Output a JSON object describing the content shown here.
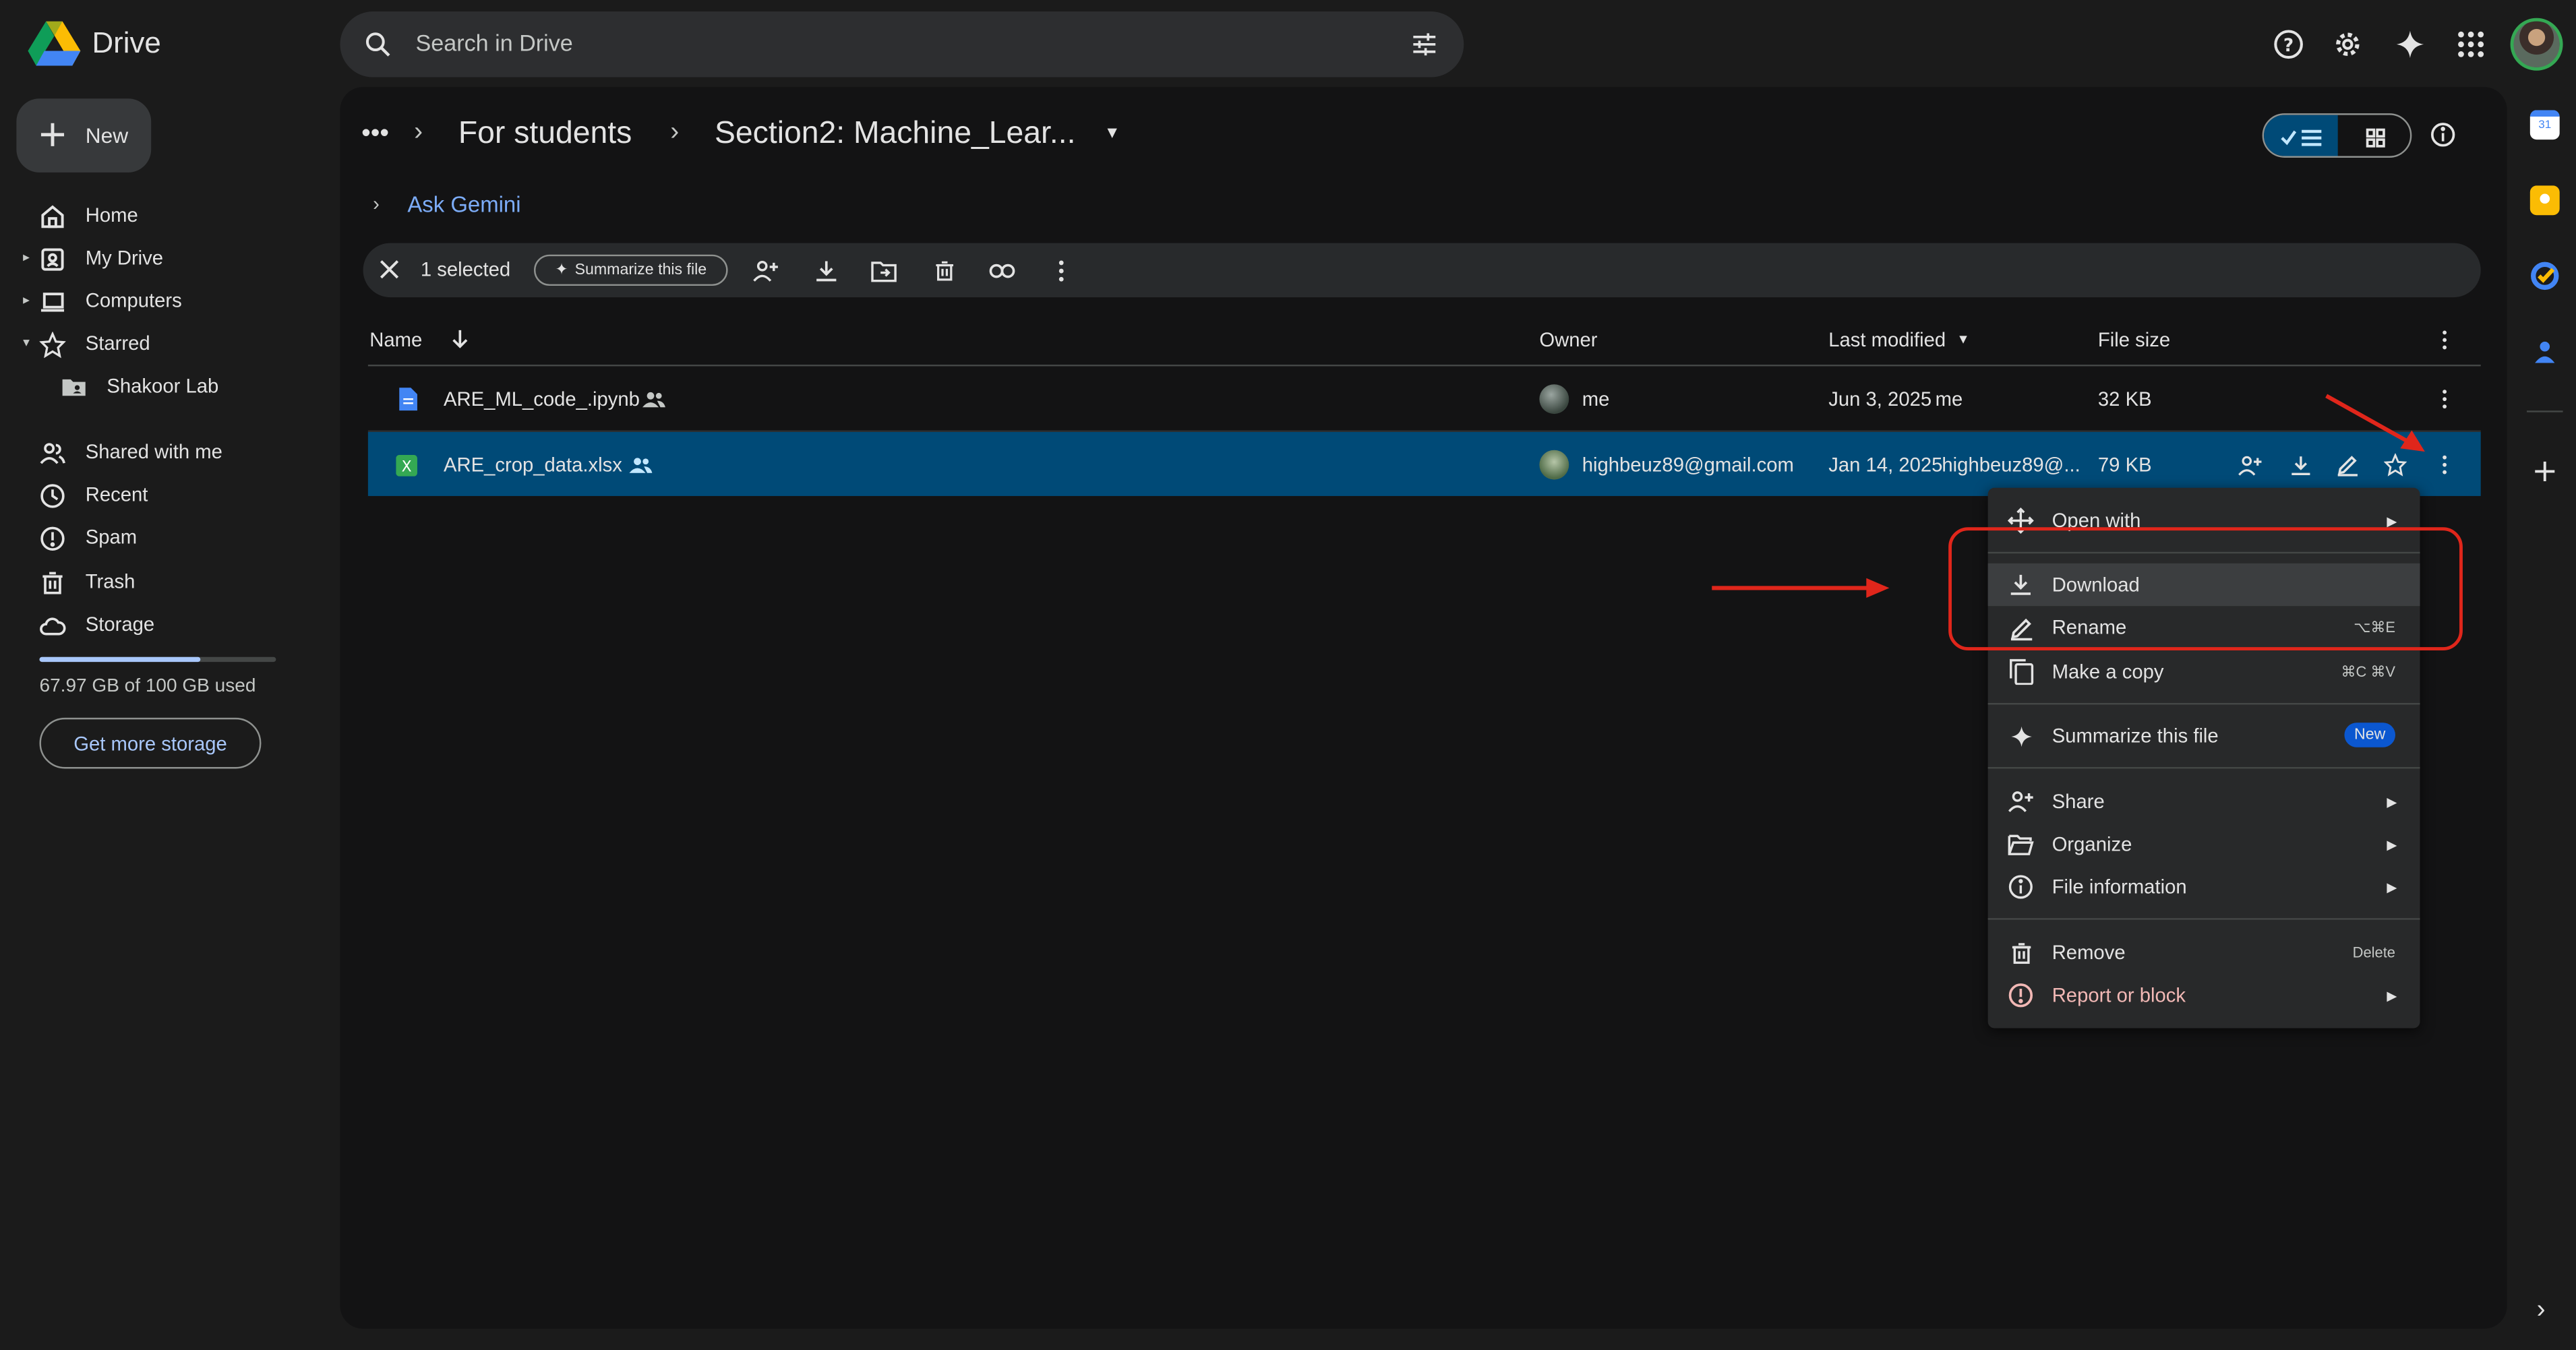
{
  "app": {
    "name": "Drive"
  },
  "search": {
    "placeholder": "Search in Drive"
  },
  "sidebar": {
    "new_label": "New",
    "items": [
      {
        "label": "Home",
        "icon": "home-icon"
      },
      {
        "label": "My Drive",
        "icon": "my-drive-icon"
      },
      {
        "label": "Computers",
        "icon": "computers-icon"
      },
      {
        "label": "Starred",
        "icon": "star-icon"
      },
      {
        "label": "Shakoor Lab",
        "icon": "shared-folder-icon"
      },
      {
        "label": "Shared with me",
        "icon": "people-icon"
      },
      {
        "label": "Recent",
        "icon": "clock-icon"
      },
      {
        "label": "Spam",
        "icon": "spam-icon"
      },
      {
        "label": "Trash",
        "icon": "trash-icon"
      },
      {
        "label": "Storage",
        "icon": "cloud-icon"
      }
    ],
    "storage_used_fraction": 0.6797,
    "storage_text": "67.97 GB of 100 GB used",
    "get_storage_label": "Get more storage"
  },
  "breadcrumb": {
    "dots": "•••",
    "parent": "For students",
    "current": "Section2: Machine_Lear..."
  },
  "gemini": {
    "label": "Ask Gemini"
  },
  "selection_bar": {
    "count_text": "1 selected",
    "summarize_label": "Summarize this file"
  },
  "table": {
    "headers": {
      "name": "Name",
      "owner": "Owner",
      "last_modified": "Last modified",
      "file_size": "File size"
    },
    "rows": [
      {
        "name": "ARE_ML_code_.ipynb",
        "owner": "me",
        "modified_date": "Jun 3, 2025",
        "modified_by": "me",
        "size": "32 KB",
        "type": "doc",
        "selected": false
      },
      {
        "name": "ARE_crop_data.xlsx",
        "owner": "highbeuz89@gmail.com",
        "modified_date": "Jan 14, 2025",
        "modified_by": "highbeuz89@...",
        "size": "79 KB",
        "type": "sheet",
        "selected": true
      }
    ]
  },
  "context_menu": {
    "open_with": "Open with",
    "download": "Download",
    "rename": "Rename",
    "rename_shortcut": "⌥⌘E",
    "make_copy": "Make a copy",
    "make_copy_shortcut": "⌘C ⌘V",
    "summarize": "Summarize this file",
    "summarize_badge": "New",
    "share": "Share",
    "organize": "Organize",
    "file_information": "File information",
    "remove": "Remove",
    "remove_shortcut": "Delete",
    "report": "Report or block"
  },
  "colors": {
    "background": "#1b1b1b",
    "panel": "#131314",
    "selected_row": "#004a77",
    "accent": "#a8c7fa",
    "annotation": "#e0261b",
    "report_text": "#f2b8b5"
  }
}
